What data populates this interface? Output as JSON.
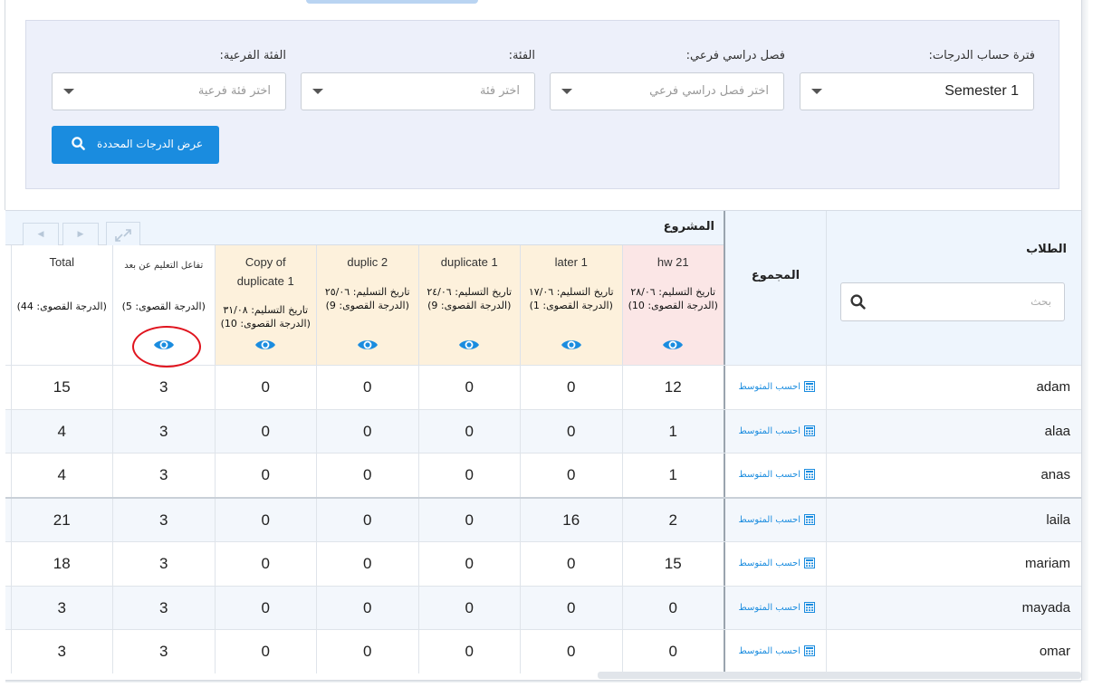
{
  "filters": {
    "period_label": "فترة حساب الدرجات:",
    "period_value": "Semester 1",
    "subterm_label": "فصل دراسي فرعي:",
    "subterm_placeholder": "اختر فصل دراسي فرعي",
    "category_label": "الفئة:",
    "category_placeholder": "اختر فئة",
    "subcategory_label": "الفئة الفرعية:",
    "subcategory_placeholder": "اختر فئة فرعية",
    "show_button": "عرض الدرجات المحددة"
  },
  "grid": {
    "students_header": "الطلاب",
    "search_placeholder": "بحث",
    "total_header": "المجموع",
    "project_header": "المشروع",
    "average_link": "احسب المتوسط",
    "columns": [
      {
        "name": "hw 21",
        "due": "تاريخ التسليم: ٢٨/٠٦",
        "max": "(الدرجة القصوى: 10)",
        "color": "#fbe6e6"
      },
      {
        "name": "later 1",
        "due": "تاريخ التسليم: ١٧/٠٦",
        "max": "(الدرجة القصوى: 1)",
        "color": "#fdf1dc"
      },
      {
        "name": "duplicate 1",
        "due": "تاريخ التسليم: ٢٤/٠٦",
        "max": "(الدرجة القصوى: 9)",
        "color": "#fdf1dc"
      },
      {
        "name": "duplic 2",
        "due": "تاريخ التسليم: ٢٥/٠٦",
        "max": "(الدرجة القصوى: 9)",
        "color": "#fdf1dc"
      },
      {
        "name": "Copy of duplicate 1",
        "due": "تاريخ التسليم: ٣١/٠٨",
        "max": "(الدرجة القصوى: 10)",
        "color": "#fdf1dc"
      },
      {
        "name": "تفاعل التعليم عن بعد",
        "due": "",
        "max": "(الدرجة القصوى: 5)",
        "color": "#ffffff"
      },
      {
        "name": "Total",
        "due": "",
        "max": "(الدرجة القصوى: 44)",
        "color": "#ffffff"
      }
    ],
    "rows": [
      {
        "name": "adam",
        "scores": [
          "12",
          "0",
          "0",
          "0",
          "0",
          "3",
          "15"
        ]
      },
      {
        "name": "alaa",
        "scores": [
          "1",
          "0",
          "0",
          "0",
          "0",
          "3",
          "4"
        ]
      },
      {
        "name": "anas",
        "scores": [
          "1",
          "0",
          "0",
          "0",
          "0",
          "3",
          "4"
        ]
      },
      {
        "name": "laila",
        "scores": [
          "2",
          "16",
          "0",
          "0",
          "0",
          "3",
          "21"
        ]
      },
      {
        "name": "mariam",
        "scores": [
          "15",
          "0",
          "0",
          "0",
          "0",
          "3",
          "18"
        ]
      },
      {
        "name": "mayada",
        "scores": [
          "0",
          "0",
          "0",
          "0",
          "0",
          "3",
          "3"
        ]
      },
      {
        "name": "omar",
        "scores": [
          "0",
          "0",
          "0",
          "0",
          "0",
          "3",
          "3"
        ]
      }
    ]
  },
  "colors": {
    "accent": "#1a8cdf",
    "highlight_ring": "#e0141e"
  },
  "icons": [
    "search-icon",
    "eye-icon",
    "calculator-icon",
    "caret-down-icon",
    "expand-icon",
    "chevron-left-icon",
    "chevron-right-icon"
  ]
}
